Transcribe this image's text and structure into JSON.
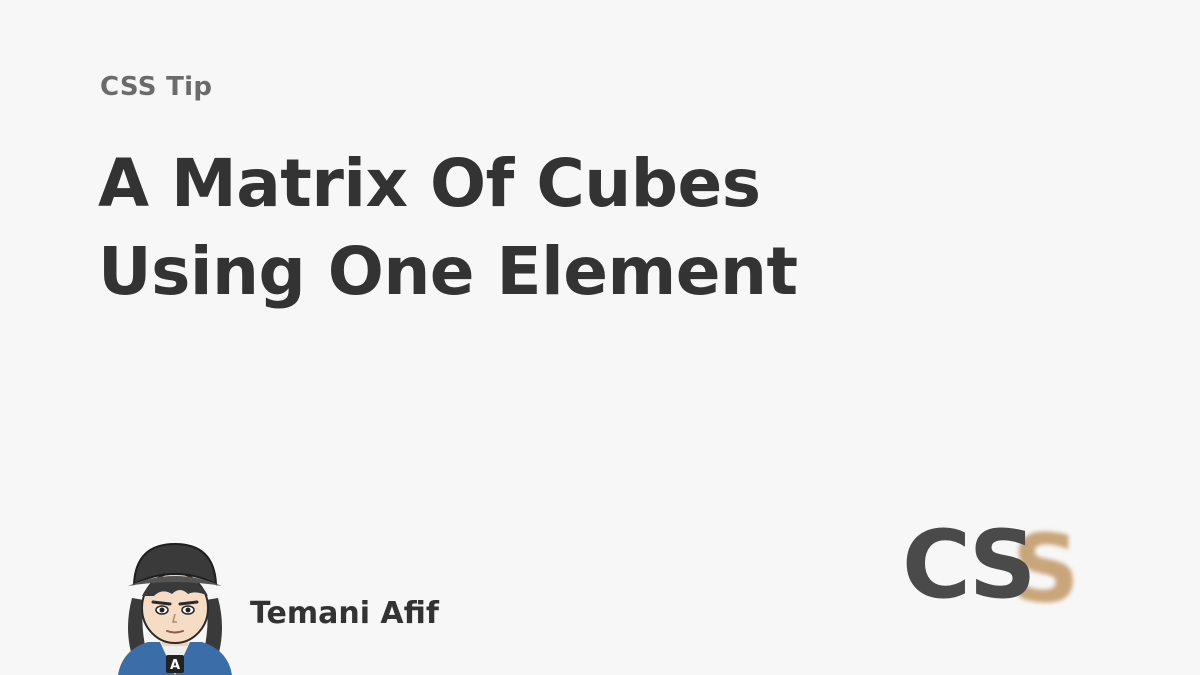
{
  "eyebrow": "CSS Tip",
  "title": {
    "line1": "A Matrix Of Cubes",
    "line2": "Using One Element"
  },
  "author": {
    "name": "Temani Afif",
    "avatar_icon": "cartoon-avatar-icon",
    "jacket_letter": "A"
  },
  "logo": {
    "text": "CSS",
    "text_color": "#4a4a4a",
    "accent_color": "#c9a57a"
  },
  "colors": {
    "background": "#f7f7f7",
    "title": "#333333",
    "eyebrow": "#6b6b6b"
  }
}
